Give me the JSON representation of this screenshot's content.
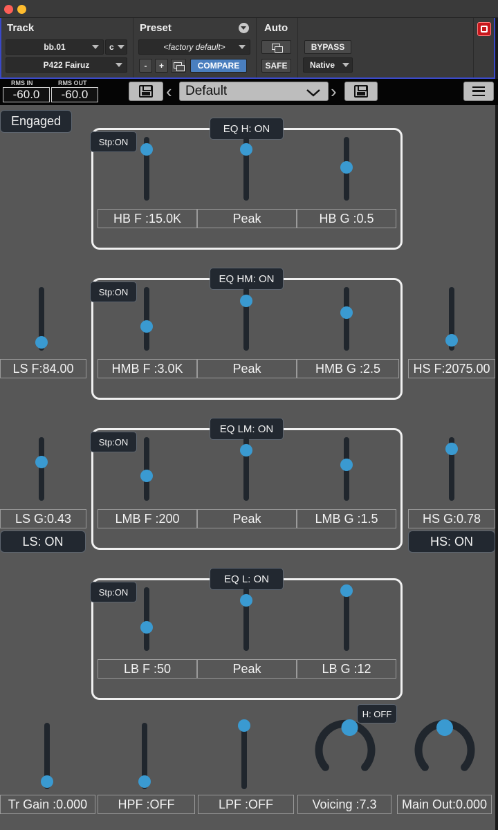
{
  "header": {
    "track_label": "Track",
    "preset_label": "Preset",
    "auto_label": "Auto",
    "track_name": "bb.01",
    "track_channel": "c",
    "insert_name": "P422 Fairuz",
    "preset_name": "<factory default>",
    "minus_label": "-",
    "plus_label": "+",
    "compare_label": "COMPARE",
    "safe_label": "SAFE",
    "bypass_label": "BYPASS",
    "native_label": "Native"
  },
  "toolbar": {
    "rms_in_label": "RMS IN",
    "rms_out_label": "RMS OUT",
    "rms_in_value": "-60.0",
    "rms_out_value": "-60.0",
    "preset_value": "Default"
  },
  "plugin": {
    "engaged_label": "Engaged",
    "bands": [
      {
        "title": "EQ H: ON",
        "stp": "Stp:ON",
        "freq": "HB F :15.0K",
        "shape": "Peak",
        "gain": "HB G :0.5"
      },
      {
        "title": "EQ HM: ON",
        "stp": "Stp:ON",
        "freq": "HMB F :3.0K",
        "shape": "Peak",
        "gain": "HMB G :2.5"
      },
      {
        "title": "EQ LM: ON",
        "stp": "Stp:ON",
        "freq": "LMB F :200",
        "shape": "Peak",
        "gain": "LMB G :1.5"
      },
      {
        "title": "EQ L: ON",
        "stp": "Stp:ON",
        "freq": "LB F :50",
        "shape": "Peak",
        "gain": "LB G :12"
      }
    ],
    "low_shelf": {
      "freq": "LS F:84.00",
      "gain": "LS G:0.43",
      "toggle": "LS: ON"
    },
    "high_shelf": {
      "freq": "HS F:2075.00",
      "gain": "HS G:0.78",
      "toggle": "HS: ON"
    },
    "bottom": {
      "trim_gain": "Tr Gain :0.000",
      "hpf": "HPF :OFF",
      "lpf": "LPF :OFF",
      "voicing": "Voicing :7.3",
      "main_out": "Main Out:0.000",
      "h_toggle": "H: OFF"
    }
  },
  "colors": {
    "accent": "#3a9ad1",
    "panel": "#575757",
    "compare": "#4a7fbf",
    "power": "#c8171c"
  },
  "icons": [
    "save-icon",
    "menu-icon",
    "chevron-left-icon",
    "chevron-right-icon",
    "chevron-down-icon",
    "power-icon",
    "copy-icon",
    "circle-dropdown-icon"
  ]
}
